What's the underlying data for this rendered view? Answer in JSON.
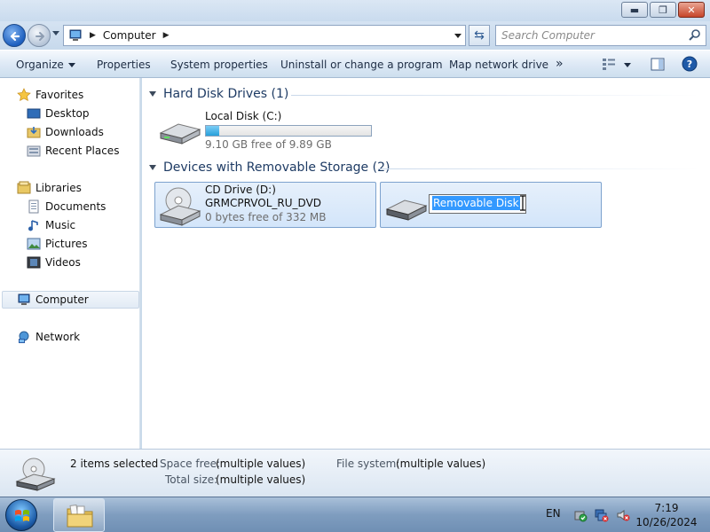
{
  "window": {
    "buttons": {
      "minimize": "▬",
      "restore": "❐",
      "close": "✕"
    }
  },
  "address": {
    "crumb": "Computer",
    "search_placeholder": "Search Computer"
  },
  "commandbar": {
    "organize": "Organize",
    "properties": "Properties",
    "system_properties": "System properties",
    "uninstall": "Uninstall or change a program",
    "map_drive": "Map network drive",
    "more": "»"
  },
  "sidebar": {
    "favorites": "Favorites",
    "desktop": "Desktop",
    "downloads": "Downloads",
    "recent": "Recent Places",
    "libraries": "Libraries",
    "documents": "Documents",
    "music": "Music",
    "pictures": "Pictures",
    "videos": "Videos",
    "computer": "Computer",
    "network": "Network"
  },
  "content": {
    "hdd_group": "Hard Disk Drives (1)",
    "local_disk": {
      "name": "Local Disk (C:)",
      "free": "9.10 GB free of 9.89 GB",
      "used_fraction": 0.08
    },
    "removable_group": "Devices with Removable Storage (2)",
    "cd_drive": {
      "name": "CD Drive (D:)",
      "label": "GRMCPRVOL_RU_DVD",
      "free": "0 bytes free of 332 MB"
    },
    "removable": {
      "rename_value": "Removable Disk"
    }
  },
  "details": {
    "selected": "2 items selected",
    "space_free_label": "Space free:",
    "space_free_value": "(multiple values)",
    "total_size_label": "Total size:",
    "total_size_value": "(multiple values)",
    "fs_label": "File system:",
    "fs_value": "(multiple values)"
  },
  "taskbar": {
    "lang": "EN",
    "time": "7:19",
    "date": "10/26/2024"
  }
}
